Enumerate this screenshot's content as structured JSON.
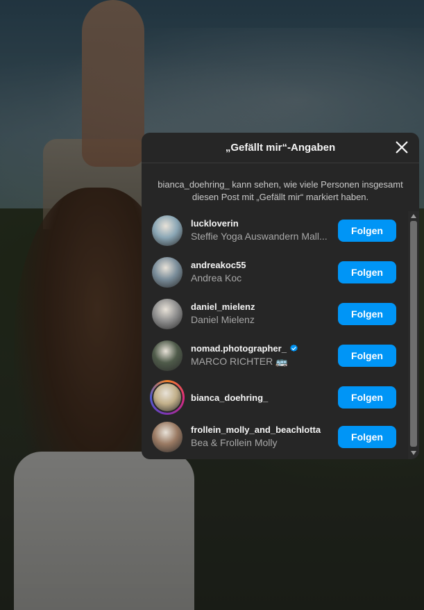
{
  "modal": {
    "title": "„Gefällt mir“-Angaben",
    "info": "bianca_doehring_ kann sehen, wie viele Personen insgesamt diesen Post mit „Gefällt mir“ markiert haben."
  },
  "follow_label": "Folgen",
  "users": [
    {
      "username": "luckloverin",
      "fullname": "Steffie Yoga Auswandern Mall...",
      "verified": false,
      "story": false,
      "avatar_color": "#8aa6b5"
    },
    {
      "username": "andreakoc55",
      "fullname": "Andrea Koc",
      "verified": false,
      "story": false,
      "avatar_color": "#7a8d9a"
    },
    {
      "username": "daniel_mielenz",
      "fullname": "Daniel Mielenz",
      "verified": false,
      "story": false,
      "avatar_color": "#8f8f8f"
    },
    {
      "username": "nomad.photographer_",
      "fullname": "MARCO RICHTER 🚌",
      "verified": true,
      "story": false,
      "avatar_color": "#4f5b4a"
    },
    {
      "username": "bianca_doehring_",
      "fullname": "",
      "verified": false,
      "story": true,
      "avatar_color": "#c2b08a"
    },
    {
      "username": "frollein_molly_and_beachlotta",
      "fullname": "Bea & Frollein Molly",
      "verified": false,
      "story": false,
      "avatar_color": "#9a7a63"
    }
  ],
  "colors": {
    "accent": "#0095f6",
    "modal_bg": "#262626"
  },
  "icons": {
    "close": "close-icon",
    "verified": "verified-badge-icon"
  }
}
